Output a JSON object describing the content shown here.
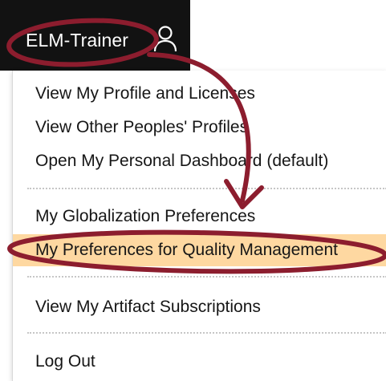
{
  "header": {
    "user_name": "ELM-Trainer",
    "user_icon": "user-icon"
  },
  "menu": {
    "items": [
      {
        "label": "View My Profile and Licenses"
      },
      {
        "label": "View Other Peoples' Profiles"
      },
      {
        "label": "Open My Personal Dashboard (default)"
      },
      {
        "label": "My Globalization Preferences"
      },
      {
        "label": "My Preferences for Quality Management"
      },
      {
        "label": "View My Artifact Subscriptions"
      },
      {
        "label": "Log Out"
      }
    ],
    "selected_item": "My Preferences for Quality Management"
  },
  "colors": {
    "topbar_bg": "#121212",
    "highlight_bg": "#fed8a1",
    "annotation": "#8c1d2e"
  }
}
